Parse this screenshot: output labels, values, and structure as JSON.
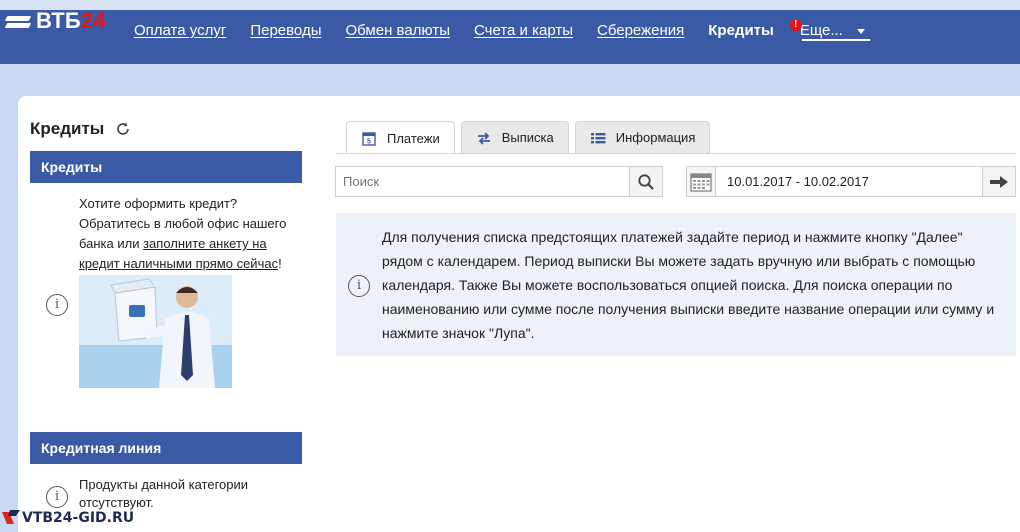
{
  "header": {
    "logo_text": "ВТБ",
    "logo_accent": "24",
    "nav": [
      {
        "label": "Оплата услуг"
      },
      {
        "label": "Переводы"
      },
      {
        "label": "Обмен валюты"
      },
      {
        "label": "Счета и карты"
      },
      {
        "label": "Сбережения"
      },
      {
        "label": "Кредиты"
      },
      {
        "label": "Еще..."
      }
    ],
    "alert_badge": "!"
  },
  "sidebar": {
    "title": "Кредиты",
    "sections": [
      {
        "heading": "Кредиты",
        "text_before_link": "Хотите оформить кредит? Обратитесь в любой офис нашего банка или ",
        "link_text": "заполните анкету на кредит наличными прямо сейчас",
        "text_after_link": "!"
      },
      {
        "heading": "Кредитная линия",
        "text": "Продукты данной категории отсутствуют."
      }
    ]
  },
  "tabs": [
    {
      "label": "Платежи",
      "icon": "calendar-5-icon",
      "active": true
    },
    {
      "label": "Выписка",
      "icon": "exchange-arrows-icon",
      "active": false
    },
    {
      "label": "Информация",
      "icon": "list-icon",
      "active": false
    }
  ],
  "search": {
    "placeholder": "Поиск"
  },
  "date_range": {
    "value": "10.01.2017 - 10.02.2017"
  },
  "info": {
    "text": "Для получения списка предстоящих платежей задайте период и нажмите кнопку \"Далее\" рядом с календарем. Период выписки Вы можете задать вручную или выбрать с помощью календаря. Также Вы можете воспользоваться опцией поиска. Для поиска операции по наименованию или сумме после получения выписки введите название операции или сумму и нажмите значок \"Лупа\"."
  },
  "watermark": {
    "text": "VTB24-GID.RU"
  },
  "colors": {
    "nav_bg": "#3b5aa6",
    "page_bg": "#c9d9f2",
    "info_bg": "#edf2f8",
    "brand_accent": "#e11111"
  }
}
